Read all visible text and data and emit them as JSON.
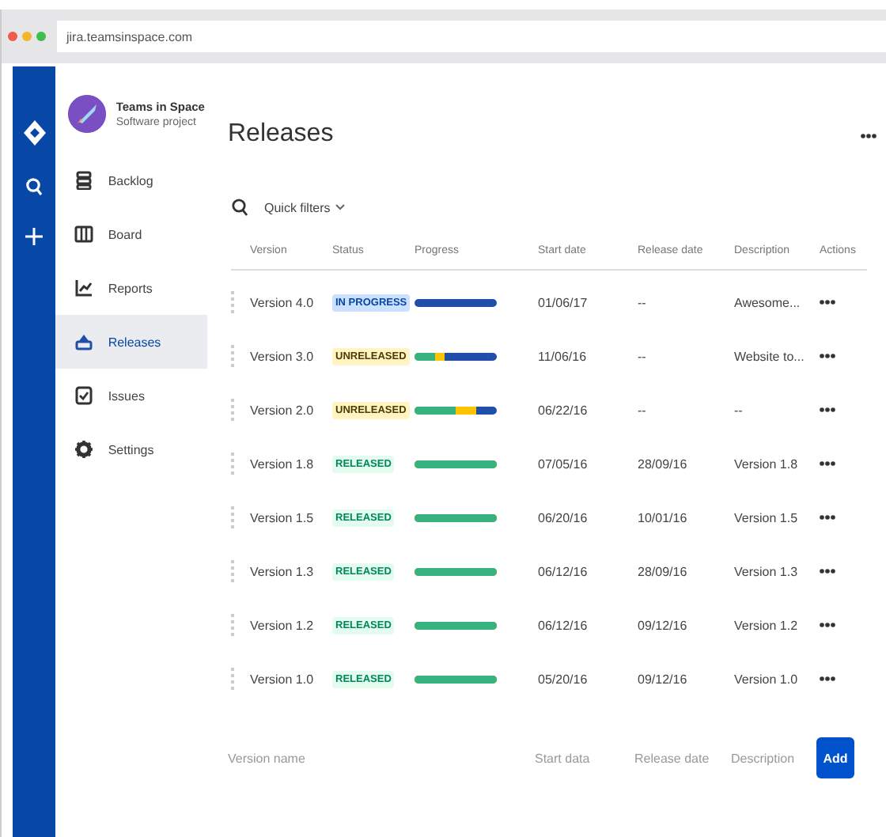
{
  "browser": {
    "url": "jira.teamsinspace.com"
  },
  "project": {
    "name": "Teams in Space",
    "type": "Software project"
  },
  "sidebar": {
    "items": [
      {
        "label": "Backlog",
        "kind": "backlog",
        "selected": false
      },
      {
        "label": "Board",
        "kind": "board",
        "selected": false
      },
      {
        "label": "Reports",
        "kind": "reports",
        "selected": false
      },
      {
        "label": "Releases",
        "kind": "releases",
        "selected": true
      },
      {
        "label": "Issues",
        "kind": "issues",
        "selected": false
      },
      {
        "label": "Settings",
        "kind": "settings",
        "selected": false
      }
    ]
  },
  "page": {
    "title": "Releases"
  },
  "filters": {
    "label": "Quick filters"
  },
  "table": {
    "columns": [
      "Version",
      "Status",
      "Progress",
      "Start date",
      "Release date",
      "Description",
      "Actions"
    ],
    "rows": [
      {
        "version": "Version 4.0",
        "status": "IN PROGRESS",
        "kind": "in_progress",
        "progress": {
          "done": {
            "level": 0
          },
          "started": {
            "level": 0
          }
        },
        "start": "01/06/17",
        "release": "--",
        "description": "Awesome..."
      },
      {
        "version": "Version 3.0",
        "status": "UNRELEASED",
        "kind": "unreleased",
        "progress": {
          "done": {
            "level": 0.25
          },
          "started": {
            "level": 0.37
          }
        },
        "start": "11/06/16",
        "release": "--",
        "description": "Website to..."
      },
      {
        "version": "Version 2.0",
        "status": "UNRELEASED",
        "kind": "unreleased",
        "progress": {
          "done": {
            "level": 0.5
          },
          "started": {
            "level": 0.75
          }
        },
        "start": "06/22/16",
        "release": "--",
        "description": "--"
      },
      {
        "version": "Version 1.8",
        "status": "RELEASED",
        "kind": "released",
        "progress": {
          "done": {
            "level": 1
          },
          "started": {
            "level": 1
          }
        },
        "start": "07/05/16",
        "release": "28/09/16",
        "description": "Version 1.8"
      },
      {
        "version": "Version 1.5",
        "status": "RELEASED",
        "kind": "released",
        "progress": {
          "done": {
            "level": 1
          },
          "started": {
            "level": 1
          }
        },
        "start": "06/20/16",
        "release": "10/01/16",
        "description": "Version 1.5"
      },
      {
        "version": "Version 1.3",
        "status": "RELEASED",
        "kind": "released",
        "progress": {
          "done": {
            "level": 1
          },
          "started": {
            "level": 1
          }
        },
        "start": "06/12/16",
        "release": "28/09/16",
        "description": "Version 1.3"
      },
      {
        "version": "Version 1.2",
        "status": "RELEASED",
        "kind": "released",
        "progress": {
          "done": {
            "level": 1
          },
          "started": {
            "level": 1
          }
        },
        "start": "06/12/16",
        "release": "09/12/16",
        "description": "Version 1.2"
      },
      {
        "version": "Version 1.0",
        "status": "RELEASED",
        "kind": "released",
        "progress": {
          "done": {
            "level": 1
          },
          "started": {
            "level": 1
          }
        },
        "start": "05/20/16",
        "release": "09/12/16",
        "description": "Version 1.0"
      }
    ]
  },
  "new_version": {
    "name_placeholder": "Version name",
    "start_placeholder": "Start data",
    "release_placeholder": "Release date",
    "description_placeholder": "Description",
    "button": "Add"
  }
}
